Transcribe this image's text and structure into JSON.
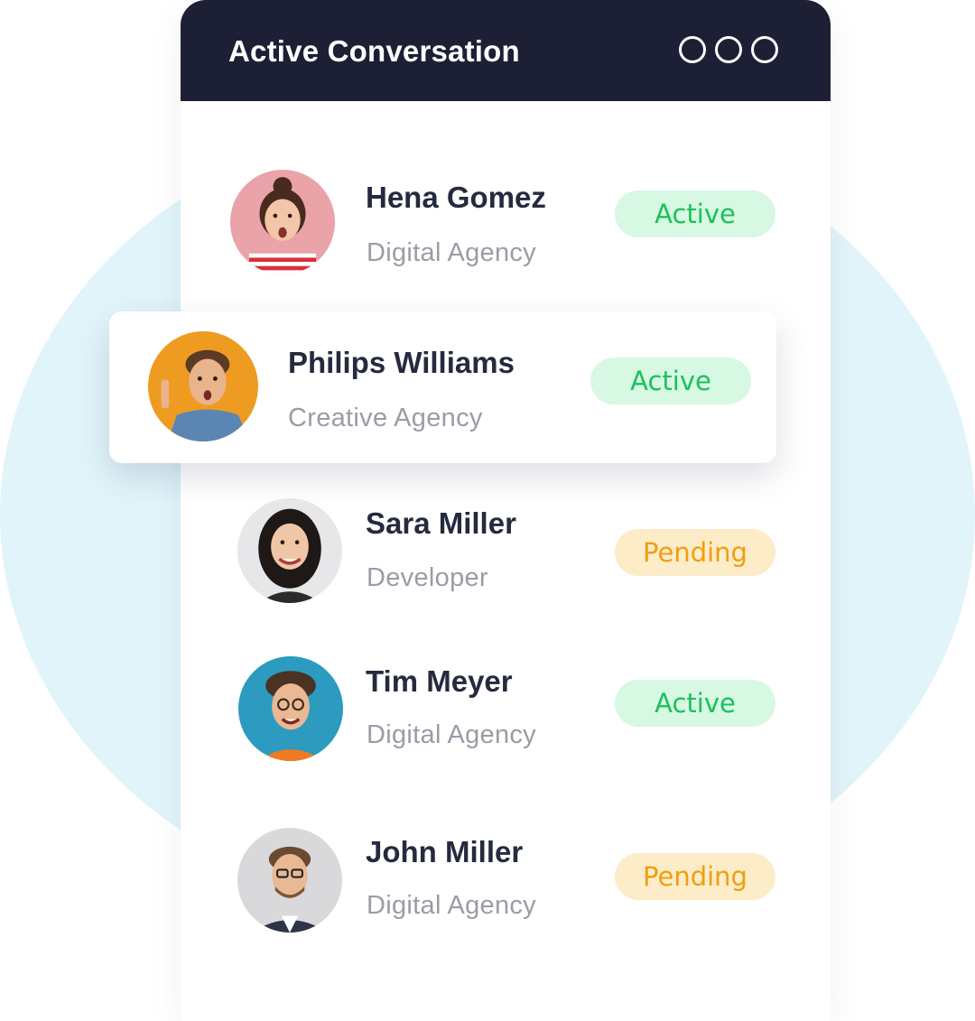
{
  "header": {
    "title": "Active Conversation"
  },
  "colors": {
    "header_bg": "#1d2035",
    "active_bg": "#d7f8e3",
    "active_text": "#1cc05b",
    "pending_bg": "#fdecc8",
    "pending_text": "#ef9f10",
    "backdrop": "#e1f4fa"
  },
  "icons": {
    "menu": "more-options-icon"
  },
  "contacts": [
    {
      "name": "Hena Gomez",
      "role": "Digital Agency",
      "status": "Active"
    },
    {
      "name": "Philips Williams",
      "role": "Creative Agency",
      "status": "Active"
    },
    {
      "name": "Sara Miller",
      "role": "Developer",
      "status": "Pending"
    },
    {
      "name": "Tim Meyer",
      "role": "Digital Agency",
      "status": "Active"
    },
    {
      "name": "John Miller",
      "role": "Digital Agency",
      "status": "Pending"
    }
  ]
}
